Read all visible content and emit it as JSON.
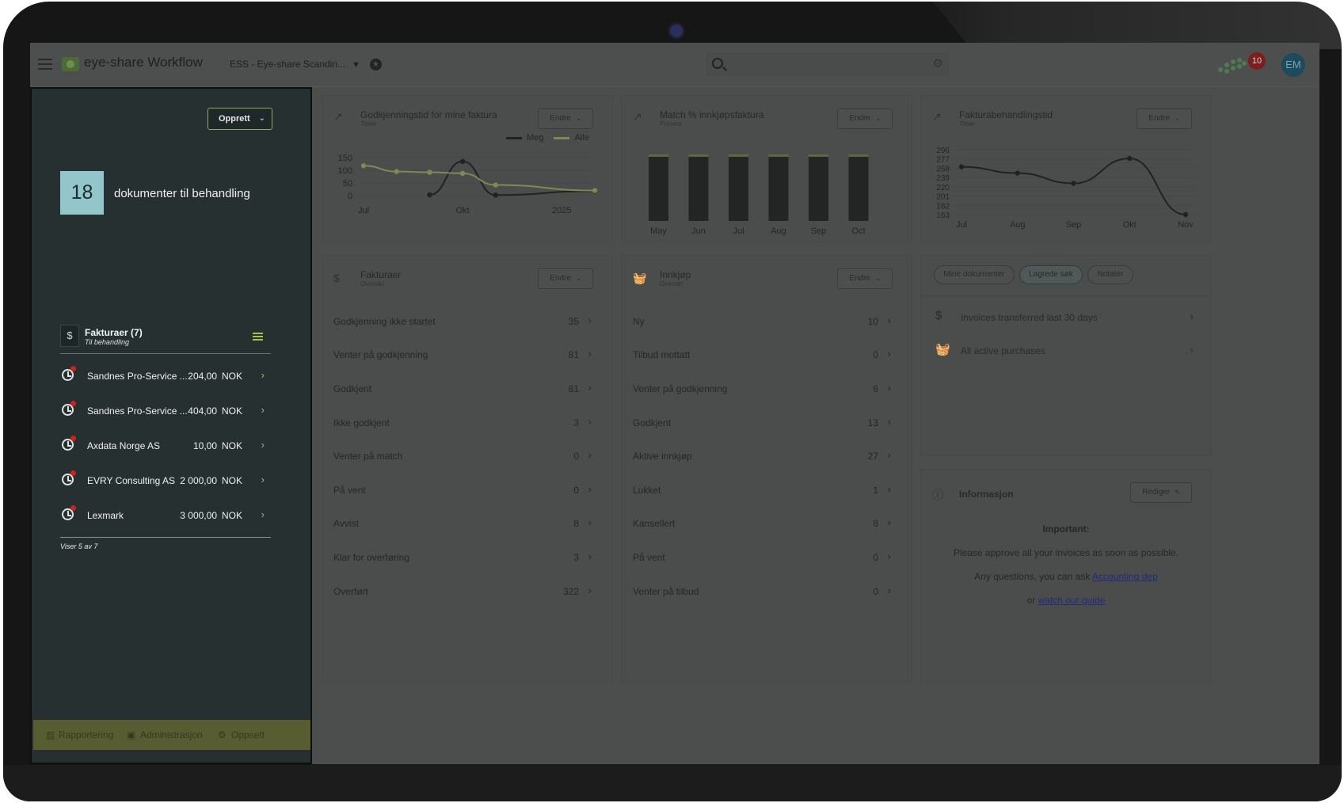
{
  "header": {
    "app_title": "eye-share Workflow",
    "company": "ESS - Eye-share Scandin...",
    "search_placeholder": "",
    "notifications_count": "10",
    "avatar_initials": "EM"
  },
  "left_panel": {
    "create_button": "Opprett",
    "doc_count": "18",
    "doc_label": "dokumenter til behandling",
    "section": {
      "title": "Fakturaer (7)",
      "subtitle": "Til behandling",
      "rows": [
        {
          "name": "Sandnes Pro-Service ...",
          "amount": "204,00",
          "currency": "NOK"
        },
        {
          "name": "Sandnes Pro-Service ...",
          "amount": "404,00",
          "currency": "NOK"
        },
        {
          "name": "Axdata Norge AS",
          "amount": "10,00",
          "currency": "NOK"
        },
        {
          "name": "EVRY Consulting AS",
          "amount": "2 000,00",
          "currency": "NOK"
        },
        {
          "name": "Lexmark",
          "amount": "3 000,00",
          "currency": "NOK"
        }
      ],
      "footer": "Viser 5 av 7"
    },
    "bottom_nav": [
      "Rapportering",
      "Administrasjon",
      "Oppsett"
    ]
  },
  "widgets": {
    "approval_time": {
      "title": "Godkjenningstid for mine faktura",
      "subtitle": "Timer",
      "button": "Endre",
      "legend": [
        "Meg",
        "Alle"
      ]
    },
    "match": {
      "title": "Match % innkjøpsfaktura",
      "subtitle": "Prosent",
      "button": "Endre"
    },
    "processing": {
      "title": "Fakturabehandlingstid",
      "subtitle": "Timer",
      "button": "Endre"
    },
    "invoices": {
      "title": "Fakturaer",
      "subtitle": "Oversikt",
      "button": "Endre",
      "rows": [
        {
          "label": "Godkjenning ikke startet",
          "value": "35"
        },
        {
          "label": "Venter på godkjenning",
          "value": "81"
        },
        {
          "label": "Godkjent",
          "value": "81"
        },
        {
          "label": "Ikke godkjent",
          "value": "3"
        },
        {
          "label": "Venter på match",
          "value": "0"
        },
        {
          "label": "På vent",
          "value": "0"
        },
        {
          "label": "Avvist",
          "value": "8"
        },
        {
          "label": "Klar for overføring",
          "value": "3"
        },
        {
          "label": "Overført",
          "value": "322"
        }
      ]
    },
    "purchases": {
      "title": "Innkjøp",
      "subtitle": "Oversikt",
      "button": "Endre",
      "rows": [
        {
          "label": "Ny",
          "value": "10"
        },
        {
          "label": "Tilbud mottatt",
          "value": "0"
        },
        {
          "label": "Venter på godkjenning",
          "value": "6"
        },
        {
          "label": "Godkjent",
          "value": "13"
        },
        {
          "label": "Aktive innkjøp",
          "value": "27"
        },
        {
          "label": "Lukket",
          "value": "1"
        },
        {
          "label": "Kansellert",
          "value": "8"
        },
        {
          "label": "På vent",
          "value": "0"
        },
        {
          "label": "Venter på tilbud",
          "value": "0"
        }
      ]
    },
    "saved": {
      "tabs": [
        "Mine dokumenter",
        "Lagrede søk",
        "Notater"
      ],
      "active_tab": "Lagrede søk",
      "rows": [
        {
          "label": "Invoices transferred last 30 days",
          "icon": "dollar-icon"
        },
        {
          "label": "All active purchases",
          "icon": "basket-icon"
        }
      ]
    },
    "info": {
      "title": "Informasjon",
      "button": "Rediger",
      "heading": "Important:",
      "line1": "Please approve all your invoices as soon as possible.",
      "line2_prefix": "Any questions, you can ask",
      "line2_link": "Accounting dep",
      "line3_prefix": "or",
      "line3_link": "watch our guide"
    }
  },
  "chart_data": [
    {
      "type": "line",
      "title": "Godkjenningstid for mine faktura",
      "xlabel": "",
      "ylabel": "",
      "x_ticks": [
        "Jul",
        "Okt",
        "2025"
      ],
      "y_ticks": [
        0,
        50,
        100,
        150
      ],
      "ylim": [
        0,
        150
      ],
      "x": [
        0,
        1,
        2,
        3,
        4,
        5,
        6,
        7
      ],
      "series": [
        {
          "name": "Meg",
          "color": "#222222",
          "values": [
            null,
            null,
            3,
            135,
            2,
            null,
            null,
            18
          ]
        },
        {
          "name": "Alle",
          "color": "#7d8a55",
          "values": [
            118,
            95,
            92,
            88,
            42,
            null,
            null,
            20
          ]
        }
      ]
    },
    {
      "type": "bar",
      "title": "Match % innkjøpsfaktura",
      "categories": [
        "May",
        "Jun",
        "Jul",
        "Aug",
        "Sep",
        "Oct"
      ],
      "values": [
        100,
        100,
        100,
        100,
        100,
        100
      ],
      "ylim": [
        0,
        100
      ]
    },
    {
      "type": "line",
      "title": "Fakturabehandlingstid",
      "categories": [
        "Jul",
        "Aug",
        "Sep",
        "Okt",
        "Nov"
      ],
      "y_ticks": [
        163,
        182,
        201,
        220,
        239,
        258,
        277,
        296
      ],
      "ylim": [
        163,
        296
      ],
      "values": [
        261,
        248,
        227,
        278,
        163
      ]
    }
  ]
}
